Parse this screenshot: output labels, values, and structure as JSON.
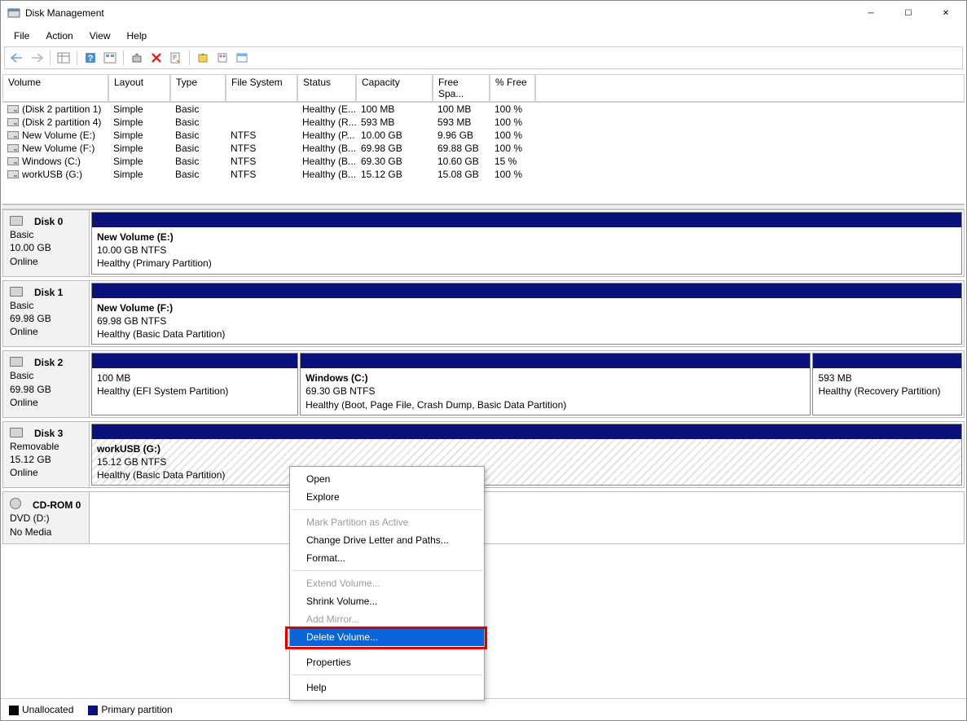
{
  "window": {
    "title": "Disk Management"
  },
  "menu": {
    "file": "File",
    "action": "Action",
    "view": "View",
    "help": "Help"
  },
  "columns": {
    "volume": "Volume",
    "layout": "Layout",
    "type": "Type",
    "fs": "File System",
    "status": "Status",
    "capacity": "Capacity",
    "free": "Free Spa...",
    "pct": "% Free"
  },
  "volumes": [
    {
      "name": "(Disk 2 partition 1)",
      "layout": "Simple",
      "type": "Basic",
      "fs": "",
      "status": "Healthy (E...",
      "cap": "100 MB",
      "free": "100 MB",
      "pct": "100 %"
    },
    {
      "name": "(Disk 2 partition 4)",
      "layout": "Simple",
      "type": "Basic",
      "fs": "",
      "status": "Healthy (R...",
      "cap": "593 MB",
      "free": "593 MB",
      "pct": "100 %"
    },
    {
      "name": "New Volume (E:)",
      "layout": "Simple",
      "type": "Basic",
      "fs": "NTFS",
      "status": "Healthy (P...",
      "cap": "10.00 GB",
      "free": "9.96 GB",
      "pct": "100 %"
    },
    {
      "name": "New Volume (F:)",
      "layout": "Simple",
      "type": "Basic",
      "fs": "NTFS",
      "status": "Healthy (B...",
      "cap": "69.98 GB",
      "free": "69.88 GB",
      "pct": "100 %"
    },
    {
      "name": "Windows (C:)",
      "layout": "Simple",
      "type": "Basic",
      "fs": "NTFS",
      "status": "Healthy (B...",
      "cap": "69.30 GB",
      "free": "10.60 GB",
      "pct": "15 %"
    },
    {
      "name": "workUSB (G:)",
      "layout": "Simple",
      "type": "Basic",
      "fs": "NTFS",
      "status": "Healthy (B...",
      "cap": "15.12 GB",
      "free": "15.08 GB",
      "pct": "100 %"
    }
  ],
  "disks": [
    {
      "id": "Disk 0",
      "sub": "Basic",
      "size": "10.00 GB",
      "state": "Online",
      "icon": "hdd",
      "parts": [
        {
          "title": "New Volume  (E:)",
          "line": "10.00 GB NTFS",
          "status": "Healthy (Primary Partition)",
          "flex": 1,
          "hatch": false
        }
      ]
    },
    {
      "id": "Disk 1",
      "sub": "Basic",
      "size": "69.98 GB",
      "state": "Online",
      "icon": "hdd",
      "parts": [
        {
          "title": "New Volume  (F:)",
          "line": "69.98 GB NTFS",
          "status": "Healthy (Basic Data Partition)",
          "flex": 1,
          "hatch": false
        }
      ]
    },
    {
      "id": "Disk 2",
      "sub": "Basic",
      "size": "69.98 GB",
      "state": "Online",
      "icon": "hdd",
      "parts": [
        {
          "title": "",
          "line": "100 MB",
          "status": "Healthy (EFI System Partition)",
          "flex": 0.25,
          "hatch": false
        },
        {
          "title": "Windows  (C:)",
          "line": "69.30 GB NTFS",
          "status": "Healthy (Boot, Page File, Crash Dump, Basic Data Partition)",
          "flex": 0.62,
          "hatch": false
        },
        {
          "title": "",
          "line": "593 MB",
          "status": "Healthy (Recovery Partition)",
          "flex": 0.18,
          "hatch": false
        }
      ]
    },
    {
      "id": "Disk 3",
      "sub": "Removable",
      "size": "15.12 GB",
      "state": "Online",
      "icon": "hdd",
      "parts": [
        {
          "title": "workUSB  (G:)",
          "line": "15.12 GB NTFS",
          "status": "Healthy (Basic Data Partition)",
          "flex": 1,
          "hatch": true
        }
      ]
    },
    {
      "id": "CD-ROM 0",
      "sub": "DVD (D:)",
      "size": "",
      "state": "No Media",
      "icon": "cd",
      "parts": []
    }
  ],
  "legend": {
    "unalloc": "Unallocated",
    "primary": "Primary partition"
  },
  "ctx": {
    "open": "Open",
    "explore": "Explore",
    "mark": "Mark Partition as Active",
    "change": "Change Drive Letter and Paths...",
    "format": "Format...",
    "extend": "Extend Volume...",
    "shrink": "Shrink Volume...",
    "addmir": "Add Mirror...",
    "delete": "Delete Volume...",
    "props": "Properties",
    "help": "Help"
  }
}
